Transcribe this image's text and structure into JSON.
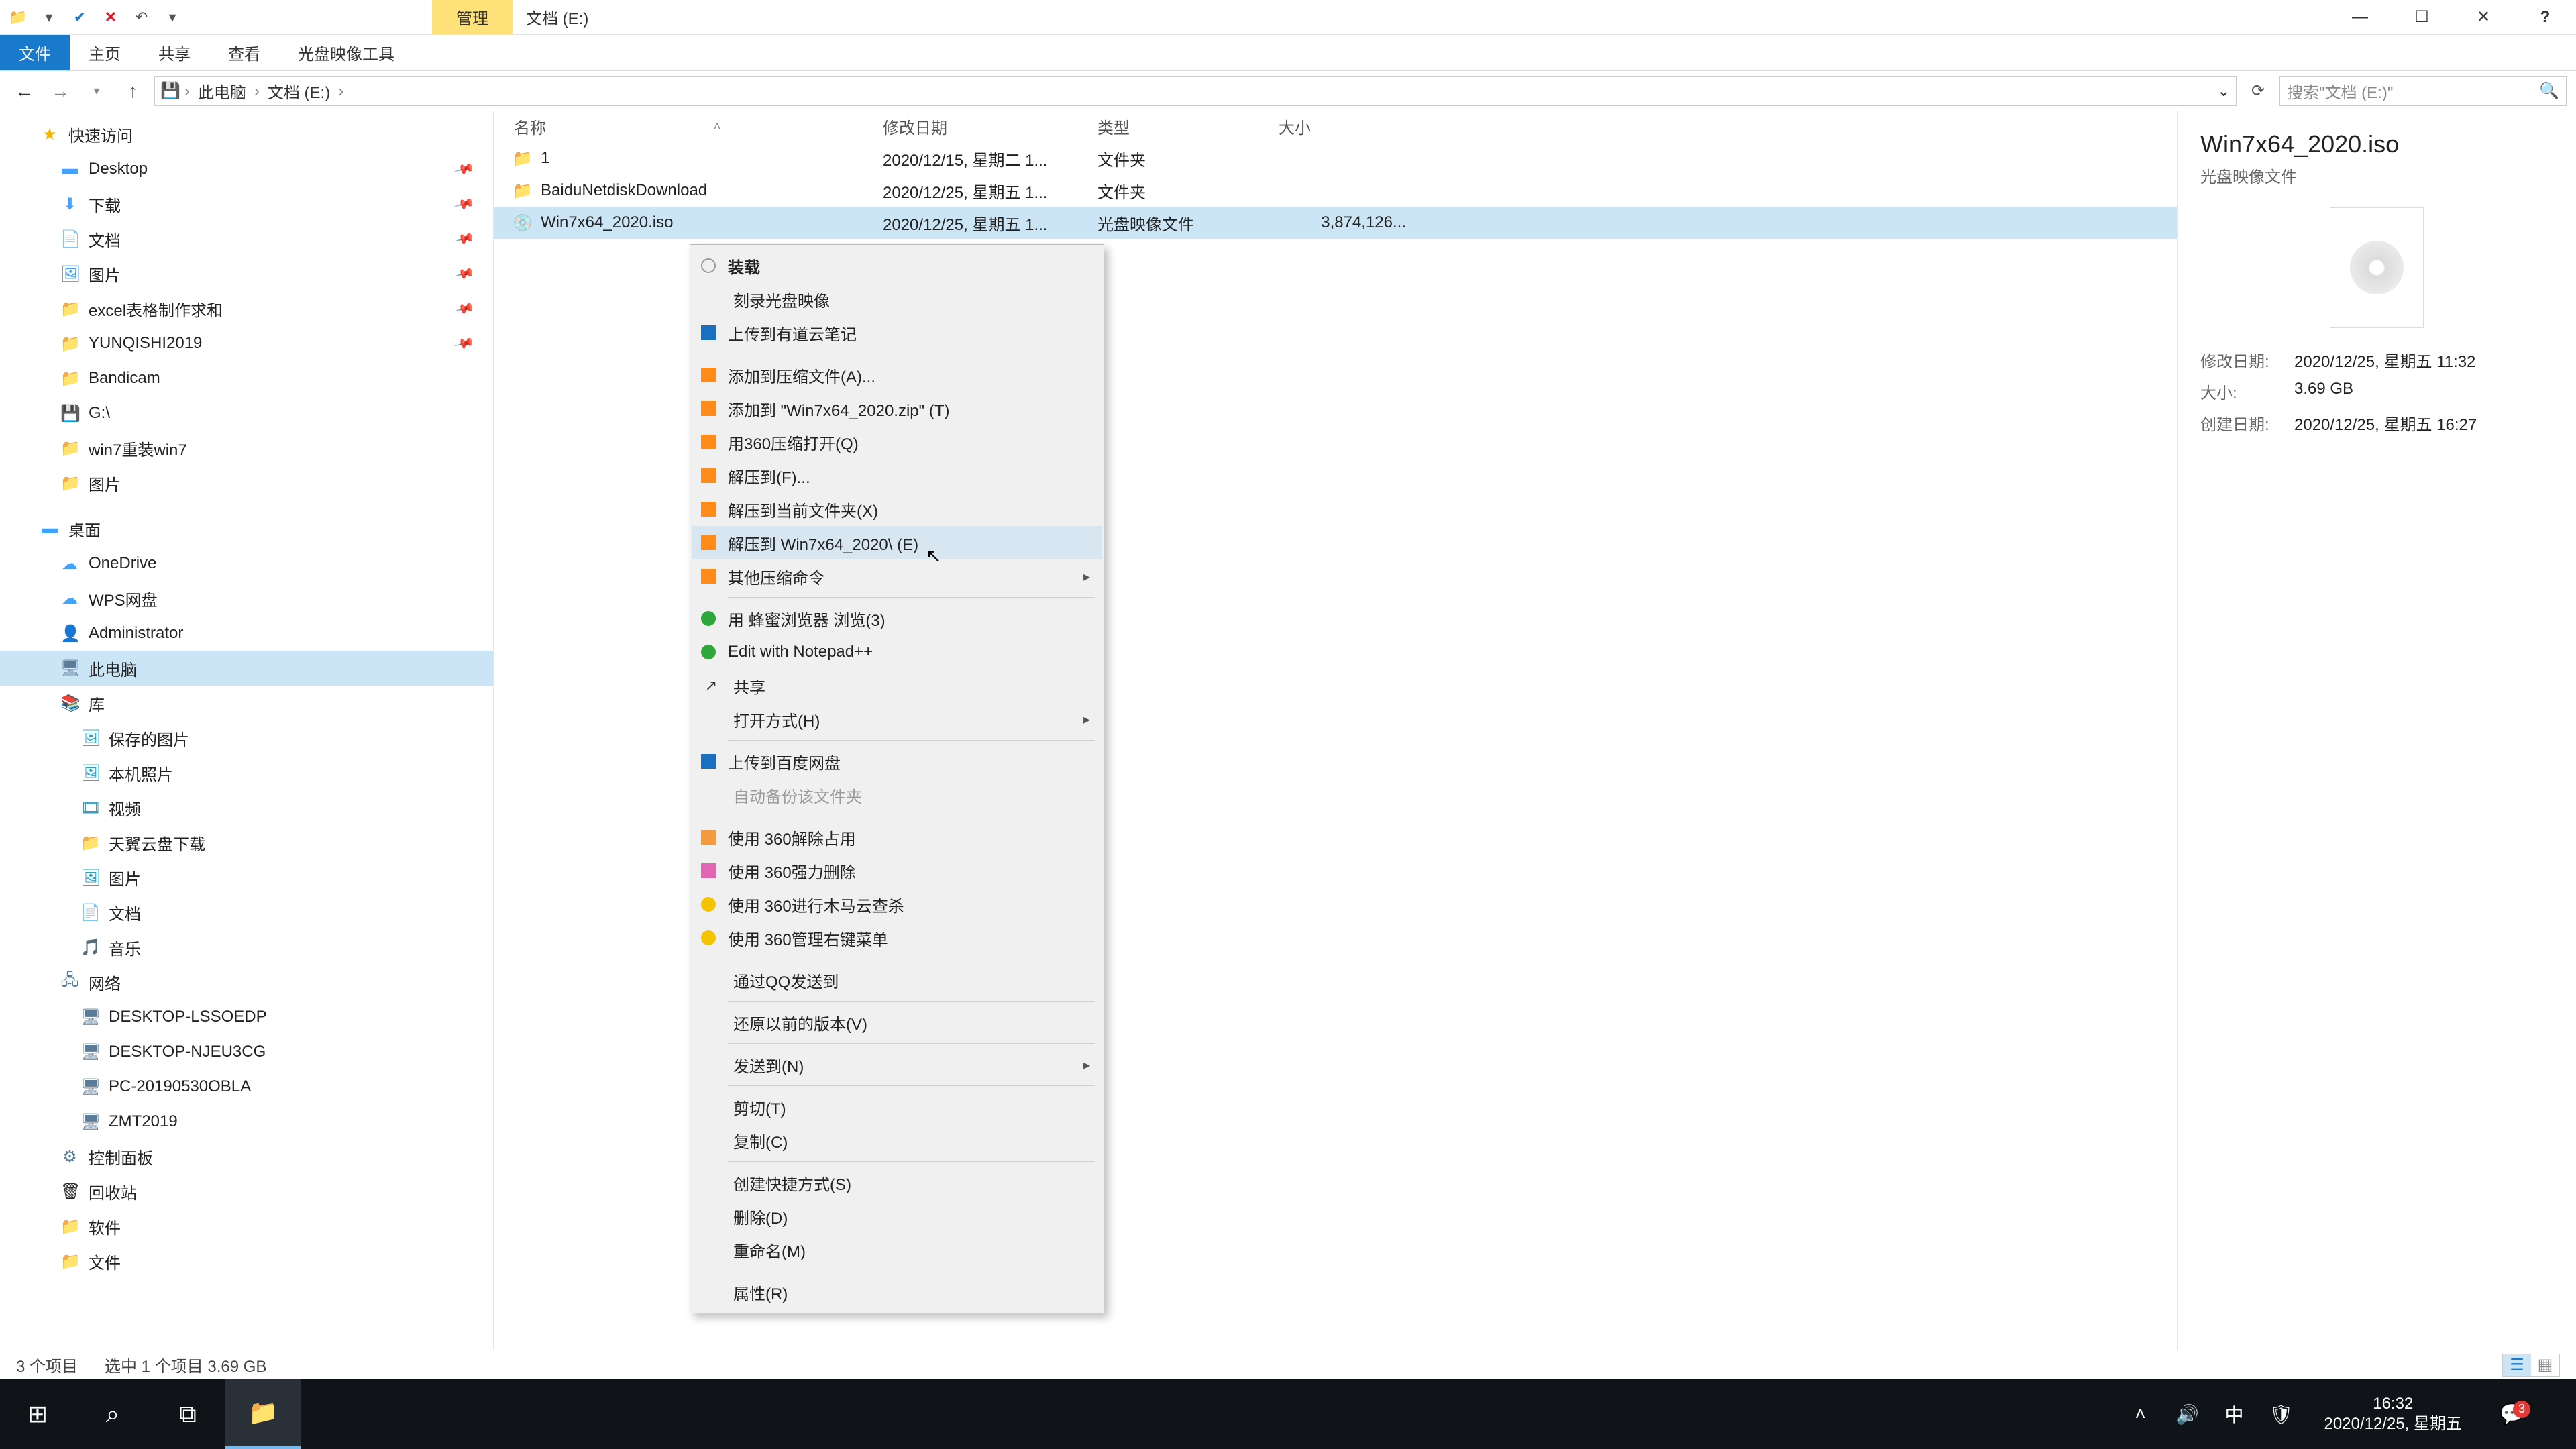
{
  "window": {
    "title": "文档 (E:)",
    "contextual_tab": "管理",
    "contextual_sub": "光盘映像工具",
    "help": "?"
  },
  "ribbon": {
    "file": "文件",
    "home": "主页",
    "share": "共享",
    "view": "查看"
  },
  "address": {
    "root": "此电脑",
    "loc": "文档 (E:)",
    "search_placeholder": "搜索\"文档 (E:)\""
  },
  "nav": {
    "quick": "快速访问",
    "desktop": "Desktop",
    "downloads": "下载",
    "documents": "文档",
    "pictures": "图片",
    "excel": "excel表格制作求和",
    "yunqishi": "YUNQISHI2019",
    "bandicam": "Bandicam",
    "gdrive": "G:\\",
    "win7reinstall": "win7重装win7",
    "pictures2": "图片",
    "desktop2": "桌面",
    "onedrive": "OneDrive",
    "wps": "WPS网盘",
    "admin": "Administrator",
    "thispc": "此电脑",
    "libraries": "库",
    "savedpics": "保存的图片",
    "localpics": "本机照片",
    "videos": "视频",
    "tianyi": "天翼云盘下载",
    "pictures3": "图片",
    "documents2": "文档",
    "music": "音乐",
    "network": "网络",
    "pc1": "DESKTOP-LSSOEDP",
    "pc2": "DESKTOP-NJEU3CG",
    "pc3": "PC-20190530OBLA",
    "pc4": "ZMT2019",
    "ctrlpanel": "控制面板",
    "recycle": "回收站",
    "software": "软件",
    "files": "文件"
  },
  "columns": {
    "name": "名称",
    "date": "修改日期",
    "type": "类型",
    "size": "大小"
  },
  "rows": [
    {
      "name": "1",
      "date": "2020/12/15, 星期二 1...",
      "type": "文件夹",
      "size": "",
      "icon": "folder"
    },
    {
      "name": "BaiduNetdiskDownload",
      "date": "2020/12/25, 星期五 1...",
      "type": "文件夹",
      "size": "",
      "icon": "folder"
    },
    {
      "name": "Win7x64_2020.iso",
      "date": "2020/12/25, 星期五 1...",
      "type": "光盘映像文件",
      "size": "3,874,126...",
      "icon": "iso"
    }
  ],
  "details": {
    "title": "Win7x64_2020.iso",
    "sub": "光盘映像文件",
    "k_mod": "修改日期:",
    "v_mod": "2020/12/25, 星期五 11:32",
    "k_size": "大小:",
    "v_size": "3.69 GB",
    "k_created": "创建日期:",
    "v_created": "2020/12/25, 星期五 16:27"
  },
  "status": {
    "count": "3 个项目",
    "selected": "选中 1 个项目  3.69 GB"
  },
  "ctx": {
    "mount": "装载",
    "burn": "刻录光盘映像",
    "youdao": "上传到有道云笔记",
    "addarchive": "添加到压缩文件(A)...",
    "addzip": "添加到 \"Win7x64_2020.zip\" (T)",
    "open360": "用360压缩打开(Q)",
    "extractto": "解压到(F)...",
    "extracthere": "解压到当前文件夹(X)",
    "extractfolder": "解压到 Win7x64_2020\\ (E)",
    "othercomp": "其他压缩命令",
    "bee": "用 蜂蜜浏览器 浏览(3)",
    "npp": "Edit with Notepad++",
    "share": "共享",
    "openwith": "打开方式(H)",
    "baidu": "上传到百度网盘",
    "autobackup": "自动备份该文件夹",
    "unlock360": "使用 360解除占用",
    "delete360": "使用 360强力删除",
    "scan360": "使用 360进行木马云查杀",
    "menu360": "使用 360管理右键菜单",
    "qq": "通过QQ发送到",
    "restore": "还原以前的版本(V)",
    "sendto": "发送到(N)",
    "cut": "剪切(T)",
    "copy": "复制(C)",
    "shortcut": "创建快捷方式(S)",
    "delete": "删除(D)",
    "rename": "重命名(M)",
    "props": "属性(R)"
  },
  "taskbar": {
    "time": "16:32",
    "date": "2020/12/25, 星期五",
    "ime": "中",
    "badge": "3"
  }
}
